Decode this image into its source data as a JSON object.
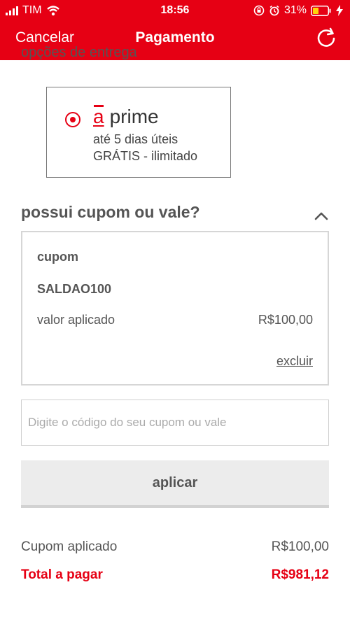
{
  "status_bar": {
    "carrier": "TIM",
    "time": "18:56",
    "battery": "31%"
  },
  "nav": {
    "cancel": "Cancelar",
    "title": "Pagamento"
  },
  "shipping": {
    "cut_heading": "opções de entrega",
    "option": {
      "brand_letter": "a",
      "brand_name": "prime",
      "line1": "até 5 dias úteis",
      "line2": "GRÁTIS - ilimitado"
    }
  },
  "coupon_section": {
    "title": "possui cupom ou vale?",
    "card": {
      "label": "cupom",
      "code": "SALDAO100",
      "value_label": "valor aplicado",
      "value": "R$100,00",
      "remove": "excluir"
    },
    "input_placeholder": "Digite o código do seu cupom ou vale",
    "apply_button": "aplicar"
  },
  "summary": {
    "coupon_label": "Cupom aplicado",
    "coupon_value": "R$100,00",
    "total_label": "Total a pagar",
    "total_value": "R$981,12"
  },
  "colors": {
    "brand": "#e60014",
    "text": "#555555"
  }
}
